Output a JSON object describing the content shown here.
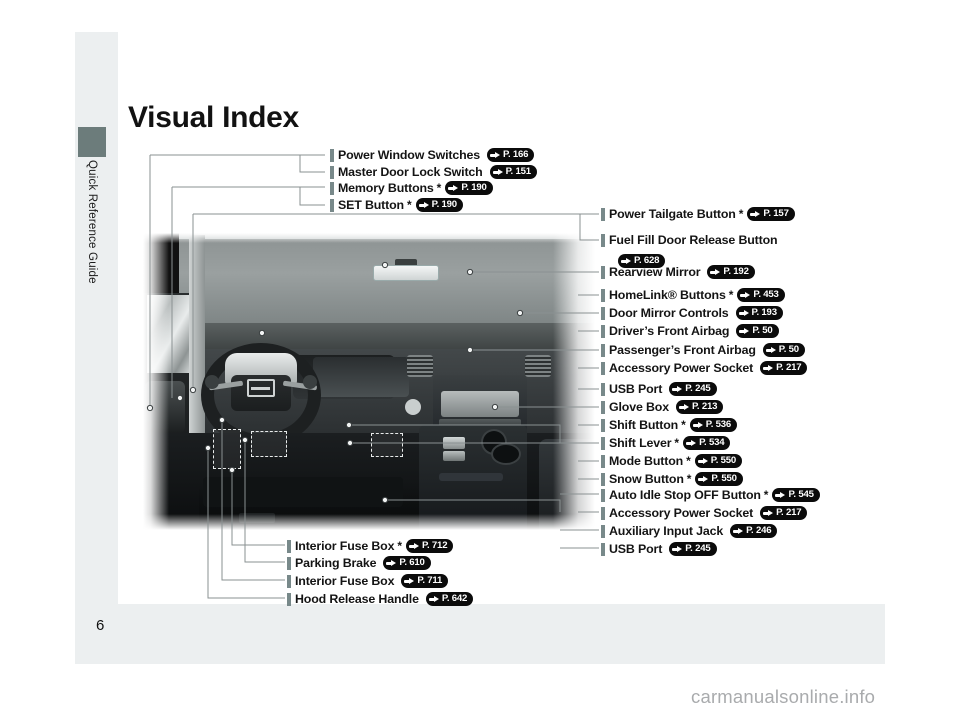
{
  "page": {
    "title": "Visual Index",
    "page_number": "6",
    "side_tab_label": "Quick Reference Guide",
    "side_tab_color": "#6c7c7b",
    "bullet_color": "#78898a",
    "band_color": "#eceff0",
    "watermark": "carmanualsonline.info"
  },
  "callouts_top_left": [
    {
      "label": "Power Window Switches",
      "star": "",
      "page_ref": "P. 166"
    },
    {
      "label": "Master Door Lock Switch",
      "star": "",
      "page_ref": "P. 151"
    },
    {
      "label": "Memory Buttons",
      "star": "*",
      "page_ref": "P. 190"
    },
    {
      "label": "SET Button",
      "star": "*",
      "page_ref": "P. 190"
    }
  ],
  "callouts_right": [
    {
      "label": "Power Tailgate Button",
      "star": "*",
      "page_ref": "P. 157"
    },
    {
      "label": "Fuel Fill Door Release Button",
      "star": "",
      "page_ref": "P. 628",
      "wrap": true
    },
    {
      "label": "Rearview Mirror",
      "star": "",
      "page_ref": "P. 192"
    },
    {
      "label": "HomeLink® Buttons",
      "star": "*",
      "page_ref": "P. 453"
    },
    {
      "label": "Door Mirror Controls",
      "star": "",
      "page_ref": "P. 193"
    },
    {
      "label": "Driver’s Front Airbag",
      "star": "",
      "page_ref": "P. 50"
    },
    {
      "label": "Passenger’s Front Airbag",
      "star": "",
      "page_ref": "P. 50"
    },
    {
      "label": "Accessory Power Socket",
      "star": "",
      "page_ref": "P. 217"
    },
    {
      "label": "USB Port",
      "star": "",
      "page_ref": "P. 245"
    },
    {
      "label": "Glove Box",
      "star": "",
      "page_ref": "P. 213"
    },
    {
      "label": "Shift Button",
      "star": "*",
      "page_ref": "P. 536"
    },
    {
      "label": "Shift Lever",
      "star": "*",
      "page_ref": "P. 534"
    },
    {
      "label": "Mode Button",
      "star": "*",
      "page_ref": "P. 550"
    },
    {
      "label": "Snow Button",
      "star": "*",
      "page_ref": "P. 550"
    },
    {
      "label": "Auto Idle Stop OFF Button",
      "star": "*",
      "page_ref": "P. 545"
    },
    {
      "label": "Accessory Power Socket",
      "star": "",
      "page_ref": "P. 217"
    },
    {
      "label": "Auxiliary Input Jack",
      "star": "",
      "page_ref": "P. 246"
    },
    {
      "label": "USB Port",
      "star": "",
      "page_ref": "P. 245"
    }
  ],
  "callouts_bottom": [
    {
      "label": "Interior Fuse Box",
      "star": "*",
      "page_ref": "P. 712"
    },
    {
      "label": "Parking Brake",
      "star": "",
      "page_ref": "P. 610"
    },
    {
      "label": "Interior Fuse Box",
      "star": "",
      "page_ref": "P. 711"
    },
    {
      "label": "Hood Release Handle",
      "star": "",
      "page_ref": "P. 642"
    }
  ],
  "photo": {
    "description": "grayscale-car-interior-dashboard"
  }
}
